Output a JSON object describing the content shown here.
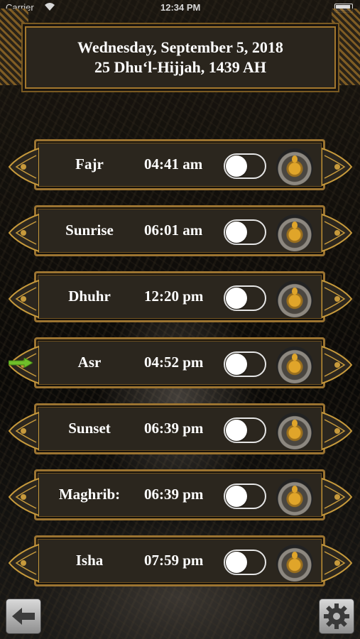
{
  "status_bar": {
    "carrier": "Carrier",
    "time": "12:34 PM"
  },
  "header": {
    "gregorian_date": "Wednesday, September 5, 2018",
    "hijri_date": "25 Dhu‘l-Hijjah, 1439 AH"
  },
  "prayers": [
    {
      "name": "Fajr",
      "time": "04:41 am",
      "alarm_on": false,
      "current": false
    },
    {
      "name": "Sunrise",
      "time": "06:01 am",
      "alarm_on": false,
      "current": false
    },
    {
      "name": "Dhuhr",
      "time": "12:20 pm",
      "alarm_on": false,
      "current": false
    },
    {
      "name": "Asr",
      "time": "04:52 pm",
      "alarm_on": false,
      "current": true
    },
    {
      "name": "Sunset",
      "time": "06:39 pm",
      "alarm_on": false,
      "current": false
    },
    {
      "name": "Maghrib:",
      "time": "06:39 pm",
      "alarm_on": false,
      "current": false
    },
    {
      "name": "Isha",
      "time": "07:59 pm",
      "alarm_on": false,
      "current": false
    }
  ],
  "icons": {
    "current_prayer": "green-arrow-right-icon",
    "alarm_settings": "bell-dial-icon",
    "back": "left-arrow-icon",
    "settings": "gear-icon"
  },
  "colors": {
    "gold": "#9c7431",
    "current_marker": "#6fbf2a",
    "bell": "#e0a52a"
  }
}
